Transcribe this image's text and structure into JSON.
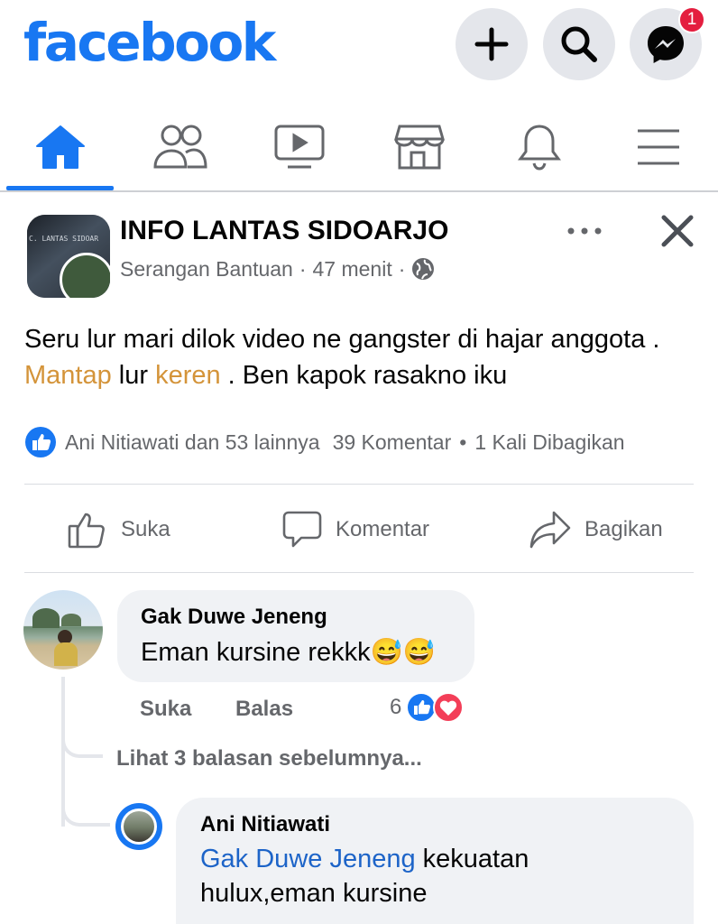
{
  "header": {
    "logo": "facebook",
    "messenger_badge": "1"
  },
  "tabs": [
    "home",
    "friends",
    "watch",
    "marketplace",
    "notifications",
    "menu"
  ],
  "post": {
    "author": "INFO LANTAS SIDOARJO",
    "avatar_caption": "C. LANTAS SIDOAR",
    "group": "Serangan Bantuan",
    "time": "47 menit",
    "text_parts": [
      "Seru lur mari dilok video ne gangster di hajar anggota . ",
      "Mantap",
      " lur ",
      "keren",
      " . Ben kapok rasakno iku"
    ],
    "reactions_text": "Ani Nitiawati dan 53 lainnya",
    "comments_count": "39 Komentar",
    "shares": "1 Kali Dibagikan",
    "actions": {
      "like": "Suka",
      "comment": "Komentar",
      "share": "Bagikan"
    }
  },
  "comment": {
    "author": "Gak Duwe Jeneng",
    "text": "Eman kursine rekkk😅😅",
    "like": "Suka",
    "reply": "Balas",
    "reaction_count": "6",
    "view_replies": "Lihat 3 balasan sebelumnya..."
  },
  "reply": {
    "author": "Ani Nitiawati",
    "mention": "Gak Duwe Jeneng",
    "text_line1": " kekuatan",
    "text_line2": "hulux,eman kursine"
  },
  "colors": {
    "brand": "#1877f2",
    "highlight": "#d4943a",
    "badge": "#e41e3f"
  }
}
